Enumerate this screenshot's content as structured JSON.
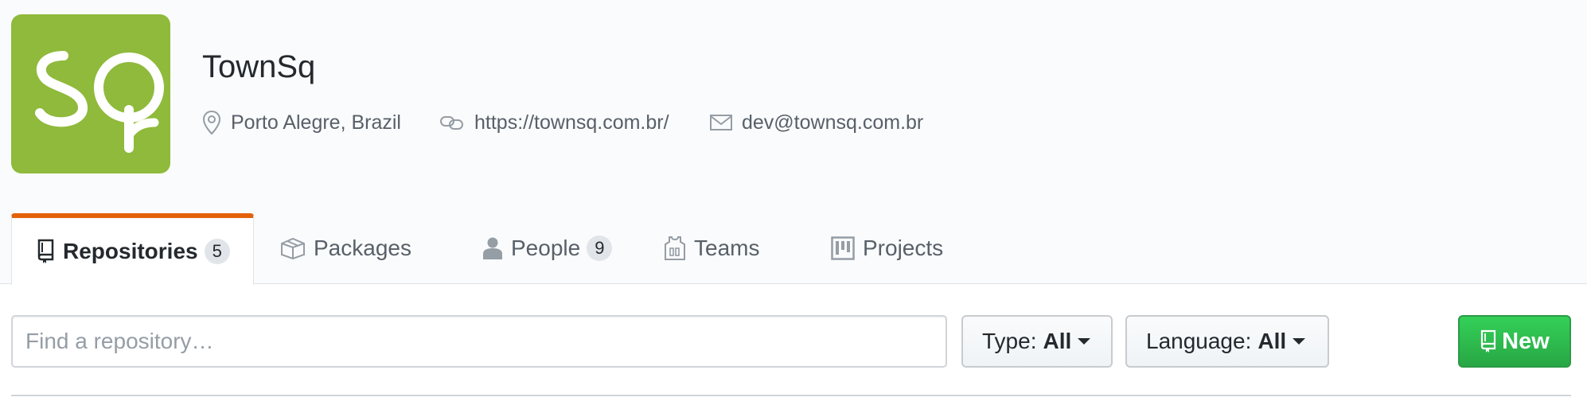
{
  "org": {
    "name": "TownSq",
    "logo_text": "Sq",
    "logo_color": "#8fba3b",
    "location": "Porto Alegre, Brazil",
    "website": "https://townsq.com.br/",
    "email": "dev@townsq.com.br"
  },
  "tabs": [
    {
      "label": "Repositories",
      "icon": "repo-icon",
      "count": "5",
      "selected": true
    },
    {
      "label": "Packages",
      "icon": "package-icon"
    },
    {
      "label": "People",
      "icon": "person-icon",
      "count": "9"
    },
    {
      "label": "Teams",
      "icon": "jersey-icon"
    },
    {
      "label": "Projects",
      "icon": "project-icon"
    }
  ],
  "toolbar": {
    "search_placeholder": "Find a repository…",
    "type_label": "Type:",
    "type_value": "All",
    "language_label": "Language:",
    "language_value": "All",
    "new_label": "New"
  },
  "colors": {
    "tab_accent": "#e36209",
    "new_button": "#28a745"
  }
}
